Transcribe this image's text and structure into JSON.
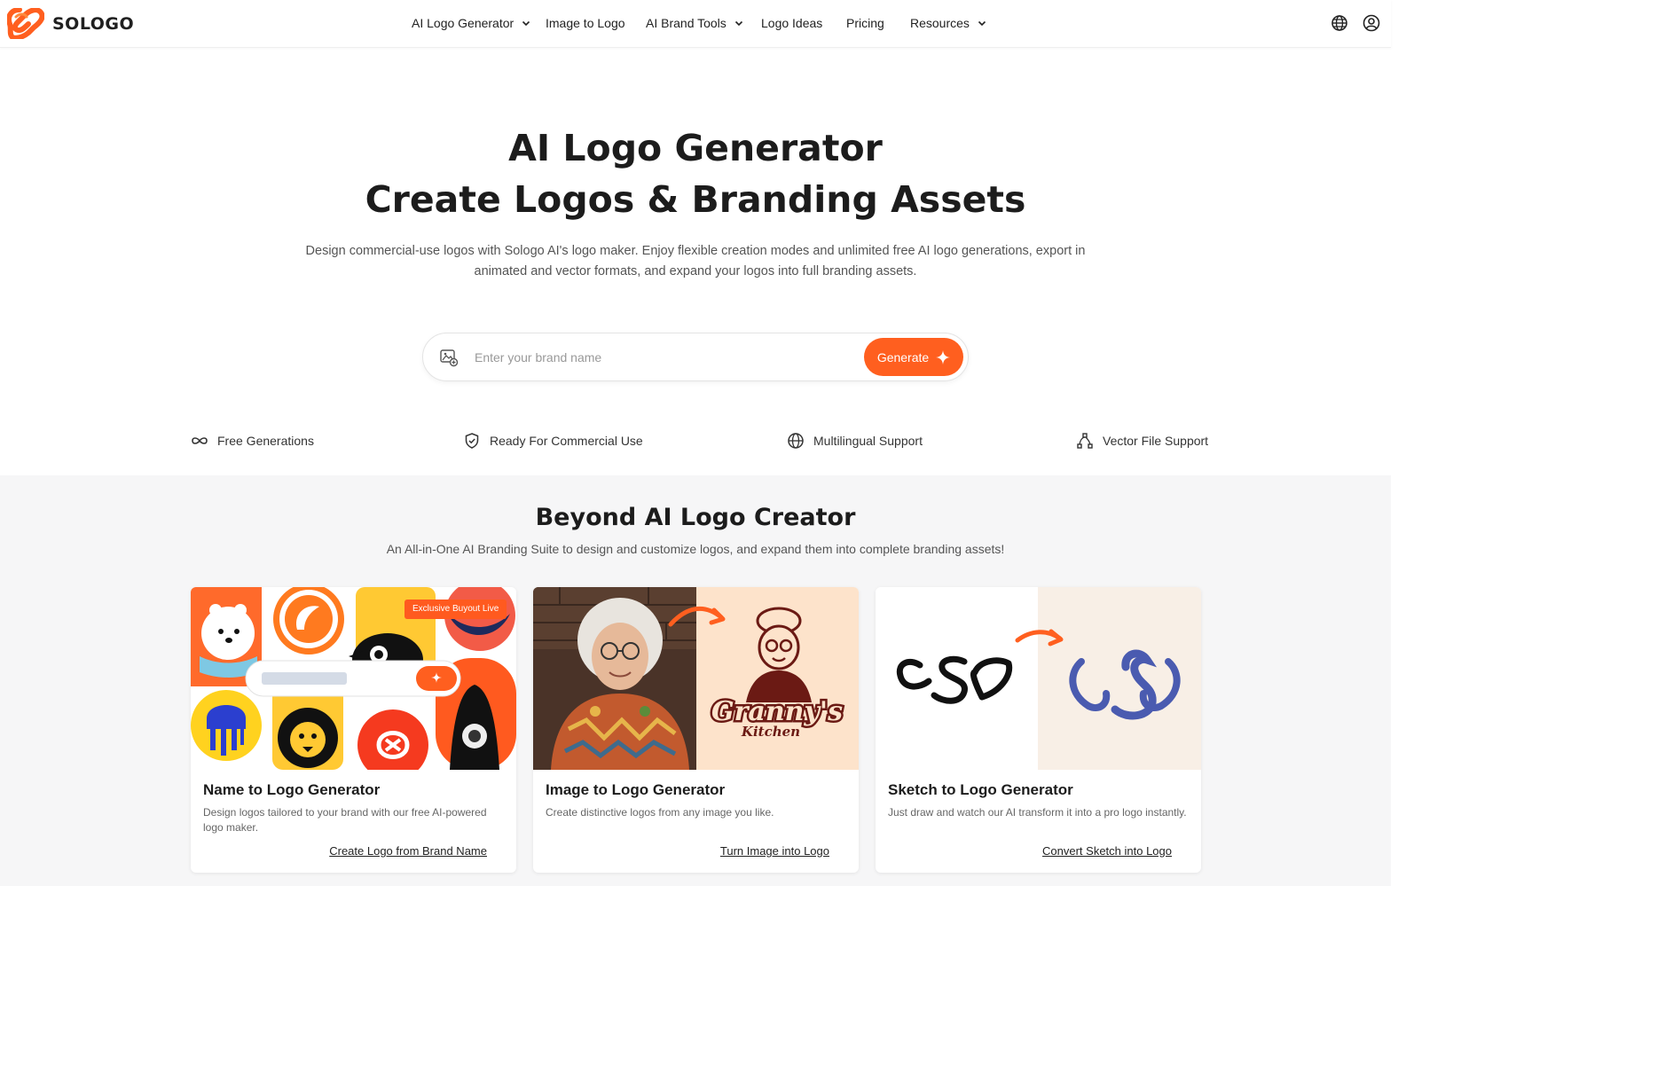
{
  "brand": {
    "name": "SOLOGO",
    "accent": "#ff5f1f"
  },
  "nav": {
    "items": [
      {
        "label": "AI Logo Generator",
        "dropdown": true
      },
      {
        "label": "Image to Logo",
        "dropdown": false
      },
      {
        "label": "AI Brand Tools",
        "dropdown": true
      },
      {
        "label": "Logo Ideas",
        "dropdown": false
      },
      {
        "label": "Pricing",
        "dropdown": false
      },
      {
        "label": "Resources",
        "dropdown": true
      }
    ],
    "icons": [
      "globe-icon",
      "account-icon"
    ]
  },
  "hero": {
    "title_line1": "AI Logo Generator",
    "title_line2": "Create Logos & Branding Assets",
    "description": "Design commercial-use logos with Sologo AI's logo maker. Enjoy flexible creation modes and unlimited free AI logo generations, export in animated and vector formats, and expand your logos into full branding assets.",
    "search": {
      "placeholder": "Enter your brand name",
      "value": ""
    },
    "generate_label": "Generate"
  },
  "features": [
    {
      "label": "Free Generations",
      "icon": "infinity-icon"
    },
    {
      "label": "Ready For Commercial Use",
      "icon": "shield-check-icon"
    },
    {
      "label": "Multilingual Support",
      "icon": "globe-icon"
    },
    {
      "label": "Vector File Support",
      "icon": "vector-nodes-icon"
    }
  ],
  "section": {
    "title": "Beyond AI Logo Creator",
    "subtitle": "An All-in-One AI Branding Suite to design and customize logos, and expand them into complete branding assets!"
  },
  "cards": [
    {
      "title": "Name to Logo Generator",
      "description": "Design logos tailored to your brand with our free AI-powered logo maker.",
      "link": "Create Logo from Brand Name",
      "badge": "Exclusive Buyout Live"
    },
    {
      "title": "Image to Logo Generator",
      "description": "Create distinctive logos from any image you like.",
      "link": "Turn Image into Logo",
      "image_text_line1": "Granny's",
      "image_text_line2": "Kitchen"
    },
    {
      "title": "Sketch to Logo Generator",
      "description": "Just draw and watch our AI transform it into a pro logo instantly.",
      "link": "Convert Sketch into Logo"
    }
  ]
}
